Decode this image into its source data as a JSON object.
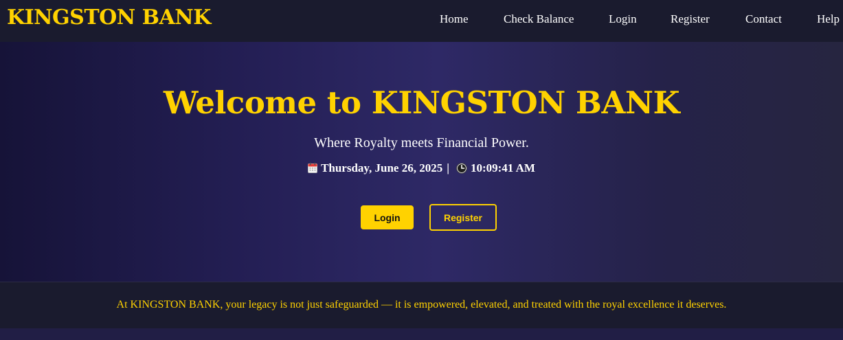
{
  "brand": {
    "name": "KINGSTON BANK",
    "accent_color": "#ffd200"
  },
  "nav": {
    "items": [
      {
        "label": "Home"
      },
      {
        "label": "Check Balance"
      },
      {
        "label": "Login"
      },
      {
        "label": "Register"
      },
      {
        "label": "Contact"
      },
      {
        "label": "Help"
      }
    ]
  },
  "hero": {
    "title": "Welcome to KINGSTON BANK",
    "tagline": "Where Royalty meets Financial Power.",
    "date_icon": "calendar-icon",
    "date": "Thursday, June 26, 2025",
    "separator": "|",
    "time_icon": "clock-icon",
    "time": "10:09:41 AM",
    "login_label": "Login",
    "register_label": "Register"
  },
  "about": {
    "text": "At KINGSTON BANK, your legacy is not just safeguarded — it is empowered, elevated, and treated with the royal excellence it deserves."
  }
}
